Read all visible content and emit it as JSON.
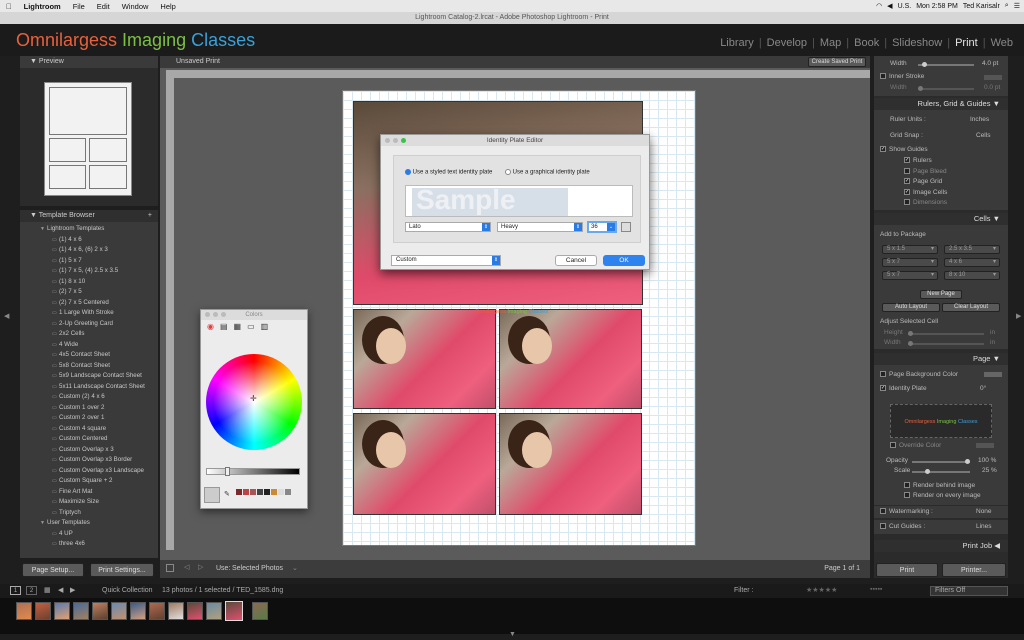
{
  "menubar": {
    "apple": "",
    "items": [
      "Lightroom",
      "File",
      "Edit",
      "Window",
      "Help"
    ],
    "locale": "U.S.",
    "clock": "Mon 2:58 PM",
    "user": "Ted Karisalr"
  },
  "window_title": "Lightroom Catalog-2.lrcat - Adobe Photoshop Lightroom - Print",
  "identity_plate": {
    "word1": "Omnilargess",
    "word2": "Imaging",
    "word3": "Classes",
    "color1": "#e8603c",
    "color2": "#7bc043",
    "color3": "#3aa0d8"
  },
  "modules": [
    "Library",
    "Develop",
    "Map",
    "Book",
    "Slideshow",
    "Print",
    "Web"
  ],
  "active_module": "Print",
  "left": {
    "preview_title": "Preview",
    "template_browser_title": "Template Browser",
    "add": "+",
    "lr_folder": "Lightroom Templates",
    "templates": [
      "(1) 4 x 6",
      "(1) 4 x 6, (6) 2 x 3",
      "(1) 5 x 7",
      "(1) 7 x 5, (4) 2.5 x 3.5",
      "(1) 8 x 10",
      "(2) 7 x 5",
      "(2) 7 x 5 Centered",
      "1 Large With Stroke",
      "2-Up Greeting Card",
      "2x2 Cells",
      "4 Wide",
      "4x5 Contact Sheet",
      "5x8 Contact Sheet",
      "5x9 Landscape Contact Sheet",
      "5x11 Landscape Contact Sheet",
      "Custom (2) 4 x 6",
      "Custom 1 over 2",
      "Custom 2 over 1",
      "Custom 4 square",
      "Custom Centered",
      "Custom Overlap x 3",
      "Custom Overlap x3 Border",
      "Custom Overlap x3 Landscape",
      "Custom Square + 2",
      "Fine Art Mat",
      "Maximize Size",
      "Triptych"
    ],
    "user_folder": "User Templates",
    "user_templates": [
      "4 UP",
      "three 4x6"
    ],
    "page_setup": "Page Setup...",
    "print_settings": "Print Settings..."
  },
  "center": {
    "title": "Unsaved Print",
    "create_saved": "Create Saved Print",
    "use_label": "Use:",
    "use_value": "Selected Photos",
    "page_count": "Page 1 of 1",
    "overlay_text": {
      "w1": "Omnilargess",
      "w2": "Imaging",
      "w3": "Classes"
    }
  },
  "idpe": {
    "title": "Identity Plate Editor",
    "opt_text": "Use a styled text identity plate",
    "opt_graphic": "Use a graphical identity plate",
    "sample": "Sample",
    "font": "Lato",
    "weight": "Heavy",
    "size": "36",
    "preset": "Custom",
    "cancel": "Cancel",
    "ok": "OK"
  },
  "colors": {
    "title": "Colors"
  },
  "right": {
    "width_label": "Width",
    "width_value": "4.0 pt",
    "inner_stroke": "Inner Stroke",
    "inner_width_label": "Width",
    "inner_width_value": "0.0 pt",
    "rulers_title": "Rulers, Grid & Guides",
    "ruler_units_label": "Ruler Units :",
    "ruler_units_value": "Inches",
    "grid_snap_label": "Grid Snap :",
    "grid_snap_value": "Cells",
    "show_guides": "Show Guides",
    "guides": [
      "Rulers",
      "Page Bleed",
      "Page Grid",
      "Image Cells",
      "Dimensions"
    ],
    "guides_checked": [
      true,
      false,
      true,
      true,
      false
    ],
    "cells_title": "Cells",
    "add_to_package": "Add to Package",
    "pkg_buttons": [
      "5 x 1.5",
      "2.5 x 3.5",
      "5 x 7",
      "4 x 6",
      "5 x 7",
      "8 x 10"
    ],
    "new_page": "New Page",
    "auto_layout": "Auto Layout",
    "clear_layout": "Clear Layout",
    "adjust_selected_cell": "Adjust Selected Cell",
    "height_label": "Height",
    "width2_label": "Width",
    "cell_unit": "in",
    "page_title": "Page",
    "page_bg_color": "Page Background Color",
    "identity_plate_label": "Identity Plate",
    "identity_plate_angle": "0°",
    "override_color": "Override Color",
    "opacity_label": "Opacity",
    "opacity_value": "100 %",
    "opacity_level": 1.0,
    "scale_label": "Scale",
    "scale_value": "25 %",
    "scale_level": 0.25,
    "render_behind": "Render behind image",
    "render_every": "Render on every image",
    "watermarking_label": "Watermarking :",
    "watermarking_value": "None",
    "cut_guides_label": "Cut Guides :",
    "cut_guides_value": "Lines",
    "print_job_title": "Print Job",
    "print": "Print",
    "printer": "Printer..."
  },
  "filmstrip": {
    "p1": "1",
    "p2": "2",
    "source": "Quick Collection",
    "info": "13 photos / 1 selected / TED_1585.dng",
    "filter_label": "Filter :",
    "filters_off": "Filters Off"
  }
}
